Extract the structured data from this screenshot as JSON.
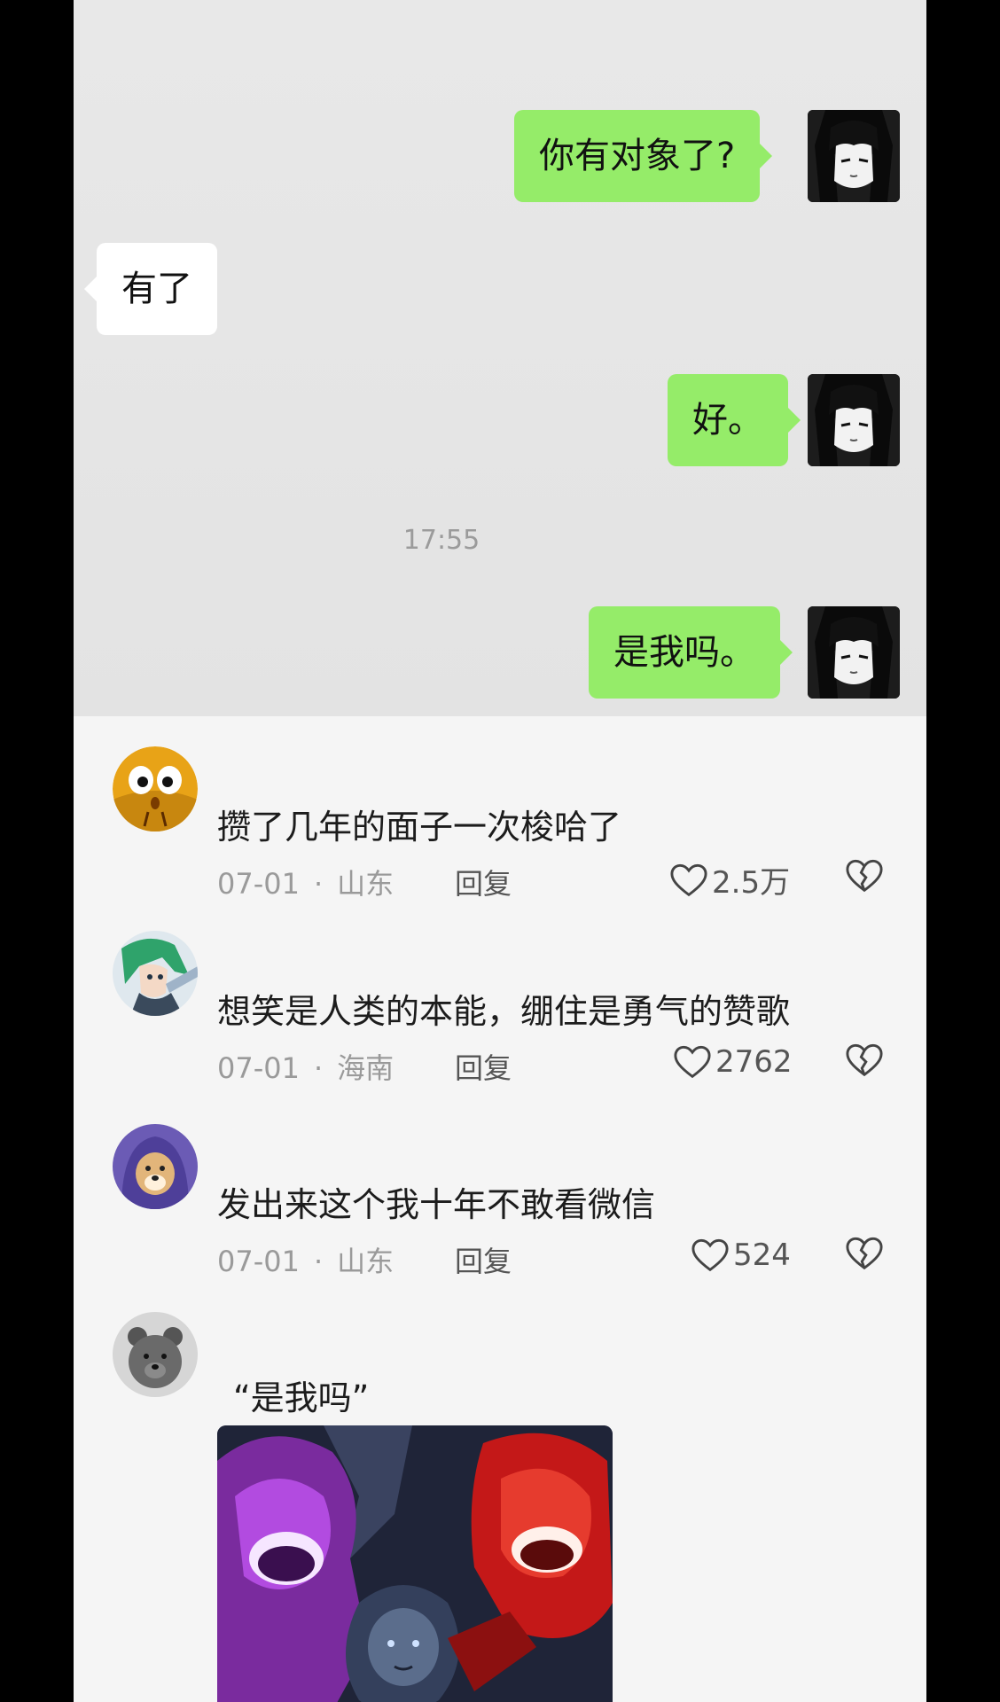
{
  "chat": {
    "messages": [
      {
        "side": "me",
        "text": "你有对象了?"
      },
      {
        "side": "other",
        "text": "有了"
      },
      {
        "side": "me",
        "text": "好。"
      },
      {
        "side": "me",
        "text": "是我吗。"
      }
    ],
    "timestamp": "17:55"
  },
  "comments": [
    {
      "text": "攒了几年的面子一次梭哈了",
      "date": "07-01",
      "location": "山东",
      "reply_label": "回复",
      "likes": "2.5万",
      "avatar_icon": "surprised-face-avatar"
    },
    {
      "text": "想笑是人类的本能，绷住是勇气的赞歌",
      "date": "07-01",
      "location": "海南",
      "reply_label": "回复",
      "likes": "2762",
      "avatar_icon": "anime-green-hair-avatar"
    },
    {
      "text": "发出来这个我十年不敢看微信",
      "date": "07-01",
      "location": "山东",
      "reply_label": "回复",
      "likes": "524",
      "avatar_icon": "hooded-dog-avatar"
    },
    {
      "text": "“是我吗”",
      "avatar_icon": "gray-bear-avatar",
      "media_icon": "laughing-characters-image"
    }
  ],
  "colors": {
    "my_bubble": "#95ec69",
    "other_bubble": "#ffffff",
    "chat_bg": "#e6e6e6",
    "comments_bg": "#f5f5f5",
    "meta_text": "#9a9a9a"
  },
  "icons": {
    "like": "heart-outline-icon",
    "dislike": "broken-heart-icon"
  }
}
